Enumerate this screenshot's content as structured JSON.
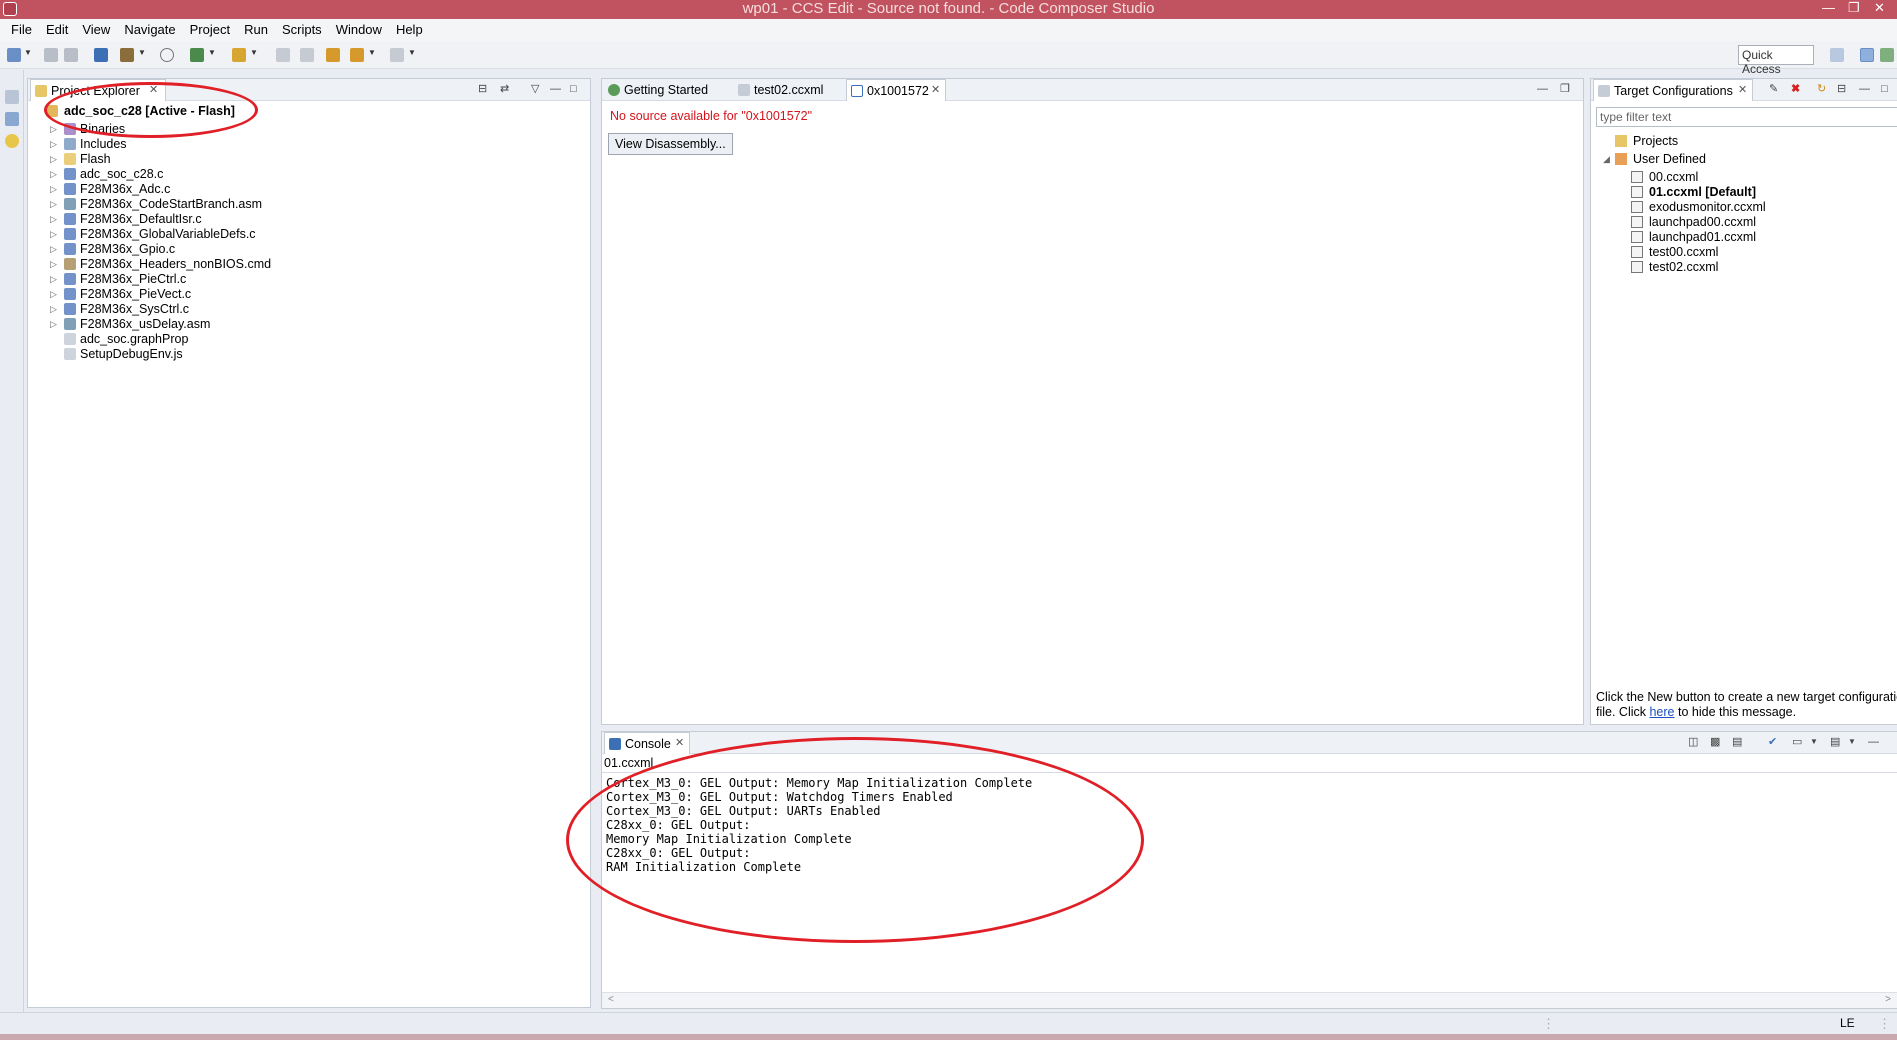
{
  "window": {
    "title": "wp01 - CCS Edit - Source not found. - Code Composer Studio",
    "controls": [
      "minimize-icon",
      "restore-icon",
      "close-icon"
    ]
  },
  "menubar": [
    "File",
    "Edit",
    "View",
    "Navigate",
    "Project",
    "Run",
    "Scripts",
    "Window",
    "Help"
  ],
  "toolbar": {
    "quick_access": "Quick Access"
  },
  "project_explorer": {
    "tab_label": "Project Explorer",
    "root": "adc_soc_c28  [Active - Flash]",
    "items": [
      {
        "label": "Binaries",
        "icon": "binaries-icon",
        "expandable": true
      },
      {
        "label": "Includes",
        "icon": "includes-icon",
        "expandable": true
      },
      {
        "label": "Flash",
        "icon": "folder-icon",
        "expandable": true
      },
      {
        "label": "adc_soc_c28.c",
        "icon": "c-file-icon",
        "expandable": true
      },
      {
        "label": "F28M36x_Adc.c",
        "icon": "c-file-icon",
        "expandable": true
      },
      {
        "label": "F28M36x_CodeStartBranch.asm",
        "icon": "asm-file-icon",
        "expandable": true
      },
      {
        "label": "F28M36x_DefaultIsr.c",
        "icon": "c-file-icon",
        "expandable": true
      },
      {
        "label": "F28M36x_GlobalVariableDefs.c",
        "icon": "c-file-icon",
        "expandable": true
      },
      {
        "label": "F28M36x_Gpio.c",
        "icon": "c-file-icon",
        "expandable": true
      },
      {
        "label": "F28M36x_Headers_nonBIOS.cmd",
        "icon": "cmd-file-icon",
        "expandable": true
      },
      {
        "label": "F28M36x_PieCtrl.c",
        "icon": "c-file-icon",
        "expandable": true
      },
      {
        "label": "F28M36x_PieVect.c",
        "icon": "c-file-icon",
        "expandable": true
      },
      {
        "label": "F28M36x_SysCtrl.c",
        "icon": "c-file-icon",
        "expandable": true
      },
      {
        "label": "F28M36x_usDelay.asm",
        "icon": "asm-file-icon",
        "expandable": true
      },
      {
        "label": "adc_soc.graphProp",
        "icon": "file-icon",
        "expandable": false
      },
      {
        "label": "SetupDebugEnv.js",
        "icon": "js-file-icon",
        "expandable": false
      }
    ]
  },
  "editor": {
    "tabs": [
      {
        "label": "Getting Started",
        "active": false
      },
      {
        "label": "test02.ccxml",
        "active": false
      },
      {
        "label": "0x1001572",
        "active": true
      }
    ],
    "message": "No source available for \"0x1001572\"",
    "button": "View Disassembly..."
  },
  "target_configurations": {
    "tab_label": "Target Configurations",
    "filter_placeholder": "type filter text",
    "tree": {
      "projects": "Projects",
      "user_defined": "User Defined",
      "files": [
        {
          "label": "00.ccxml",
          "bold": false
        },
        {
          "label": "01.ccxml [Default]",
          "bold": true
        },
        {
          "label": "exodusmonitor.ccxml",
          "bold": false
        },
        {
          "label": "launchpad00.ccxml",
          "bold": false
        },
        {
          "label": "launchpad01.ccxml",
          "bold": false
        },
        {
          "label": "test00.ccxml",
          "bold": false
        },
        {
          "label": "test02.ccxml",
          "bold": false
        }
      ]
    },
    "hint_prefix": "Click the New button to create a new target configuration",
    "hint_line2_prefix": "file. Click ",
    "hint_link": "here",
    "hint_suffix": " to hide this message."
  },
  "console": {
    "tab_label": "Console",
    "session": "01.ccxml",
    "lines": [
      "Cortex_M3_0: GEL Output: Memory Map Initialization Complete",
      "Cortex_M3_0: GEL Output: Watchdog Timers Enabled",
      "Cortex_M3_0: GEL Output: UARTs Enabled",
      "C28xx_0: GEL Output:",
      "Memory Map Initialization Complete",
      "C28xx_0: GEL Output:",
      "RAM Initialization Complete"
    ]
  },
  "statusbar": {
    "encoding": "LE"
  },
  "colors": {
    "titlebar": "#c1525f",
    "annotation": "#e01f26",
    "error_text": "#d4141c",
    "link": "#1a4fc1"
  }
}
